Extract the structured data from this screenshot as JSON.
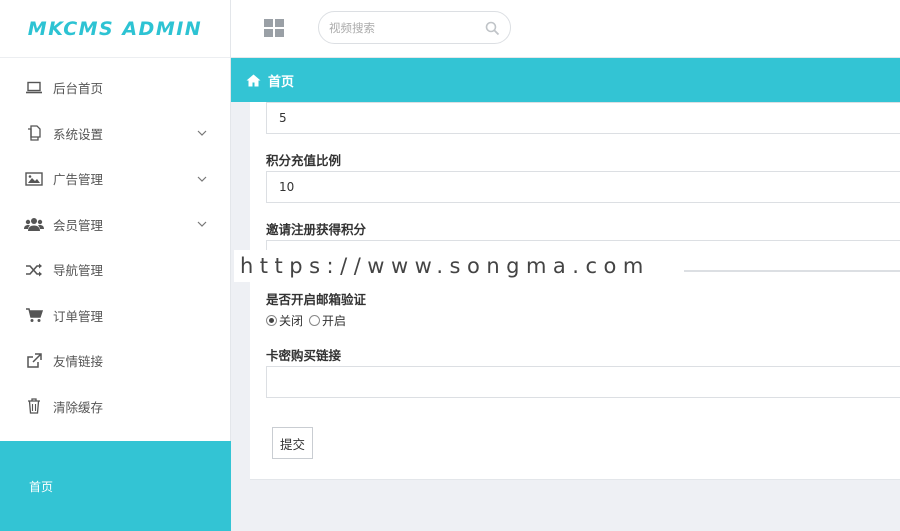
{
  "app": {
    "logo_text": "MKCMS ADMIN",
    "accent_color": "#33c4d4"
  },
  "sidebar": {
    "items": [
      {
        "label": "后台首页",
        "icon": "laptop-icon",
        "has_submenu": false
      },
      {
        "label": "系统设置",
        "icon": "copy-icon",
        "has_submenu": true
      },
      {
        "label": "广告管理",
        "icon": "image-icon",
        "has_submenu": true
      },
      {
        "label": "会员管理",
        "icon": "users-icon",
        "has_submenu": true
      },
      {
        "label": "导航管理",
        "icon": "shuffle-icon",
        "has_submenu": false
      },
      {
        "label": "订单管理",
        "icon": "cart-icon",
        "has_submenu": false
      },
      {
        "label": "友情链接",
        "icon": "external-link-icon",
        "has_submenu": false
      },
      {
        "label": "清除缓存",
        "icon": "trash-icon",
        "has_submenu": false
      }
    ],
    "footer_label": "首页"
  },
  "topbar": {
    "search_placeholder": "视频搜索"
  },
  "page_header": {
    "title": "首页"
  },
  "form": {
    "field1": {
      "value": "5"
    },
    "field2": {
      "label": "积分充值比例",
      "value": "10"
    },
    "field3": {
      "label": "邀请注册获得积分",
      "value": ""
    },
    "field4": {
      "label": "是否开启邮箱验证",
      "options": [
        "关闭",
        "开启"
      ],
      "selected": "关闭"
    },
    "field5": {
      "label": "卡密购买链接",
      "value": ""
    },
    "submit_label": "提交"
  },
  "watermark": {
    "text": "https://www.songma.com"
  }
}
